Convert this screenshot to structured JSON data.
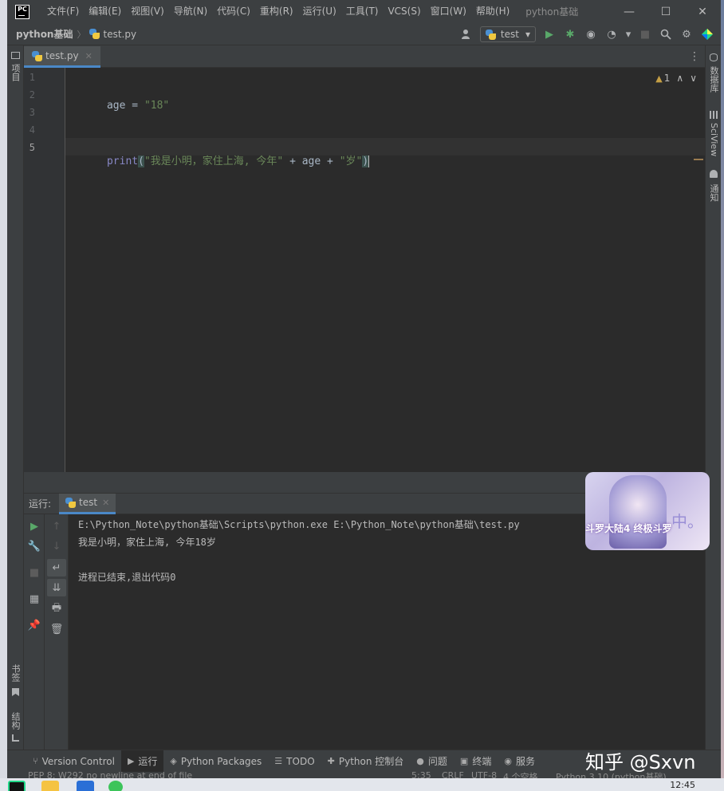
{
  "titlebar": {
    "app_logo": "PC",
    "menu": [
      "文件(F)",
      "编辑(E)",
      "视图(V)",
      "导航(N)",
      "代码(C)",
      "重构(R)",
      "运行(U)",
      "工具(T)",
      "VCS(S)",
      "窗口(W)",
      "帮助(H)"
    ],
    "title": "python基础",
    "minimize": "—",
    "maximize": "☐",
    "close": "✕"
  },
  "navbar": {
    "project": "python基础",
    "separator": "〉",
    "file": "test.py",
    "run_config": "test",
    "run_config_arrow": "▾",
    "user_icon": "user-icon",
    "run_icon": "▶",
    "debug_icon": "✱",
    "coverage_icon": "◉",
    "profile_icon": "◔",
    "stop_icon": "■",
    "search_icon": "🔍",
    "settings_icon": "⚙",
    "logo_icon": "◆",
    "more_arrow": "▾"
  },
  "left_strip": {
    "project": "项目",
    "bookmarks": "书签",
    "structure": "结构"
  },
  "right_strip": {
    "database": "数据库",
    "sciview": "SciView",
    "notifications": "通知"
  },
  "editor": {
    "tab_label": "test.py",
    "tab_close": "✕",
    "tabs_menu": "⋮",
    "warnings_count": "1",
    "warning_symbol": "▲",
    "nav_up": "∧",
    "nav_down": "∨",
    "line_numbers": [
      "1",
      "2",
      "3",
      "4",
      "5"
    ],
    "current_line": 5,
    "line2": {
      "var": "age",
      "op": " = ",
      "str": "\"18\""
    },
    "line5": {
      "fn": "print",
      "open": "(",
      "str1": "\"我是小明，家住上海, 今年\"",
      "op1": " + ",
      "var": "age",
      "op2": " + ",
      "str2": "\"岁\"",
      "close": ")"
    }
  },
  "run_panel": {
    "label": "运行:",
    "tab": "test",
    "tab_close": "✕",
    "settings_icon": "⚙",
    "minimize_icon": "—",
    "console_lines": [
      "E:\\Python_Note\\python基础\\Scripts\\python.exe E:\\Python_Note\\python基础\\test.py",
      "我是小明，家住上海, 今年18岁",
      "",
      "进程已结束,退出代码0"
    ],
    "toolbar1": [
      "▶",
      "🔧",
      "■",
      "▦",
      "📌"
    ],
    "toolbar2": [
      "↑",
      "↓",
      "↵",
      "⇊",
      "🖶",
      "🗑"
    ]
  },
  "bottombar": {
    "items": [
      {
        "icon": "⑂",
        "label": "Version Control"
      },
      {
        "icon": "▶",
        "label": "运行"
      },
      {
        "icon": "◈",
        "label": "Python Packages"
      },
      {
        "icon": "☰",
        "label": "TODO"
      },
      {
        "icon": "✚",
        "label": "Python 控制台"
      },
      {
        "icon": "●",
        "label": "问题"
      },
      {
        "icon": "▣",
        "label": "终端"
      },
      {
        "icon": "◉",
        "label": "服务"
      }
    ]
  },
  "statusbar": {
    "left": "PEP 8: W292 no newline at end of file",
    "position": "5:35",
    "line_sep": "CRLF",
    "encoding": "UTF-8",
    "indent": "4 个空格",
    "interpreter": "Python 3.10 (python基础)"
  },
  "taskbar": {
    "clock": "12:45"
  },
  "watermark": "知乎 @Sxvn",
  "sticker": {
    "text": "中。",
    "title": "斗罗大陆4 终极斗罗"
  },
  "colors": {
    "background": "#2b2b2b",
    "panel": "#3c3f41",
    "string": "#6a8759",
    "builtin": "#8888c6",
    "accent": "#4a88c7",
    "run_green": "#59a869"
  }
}
